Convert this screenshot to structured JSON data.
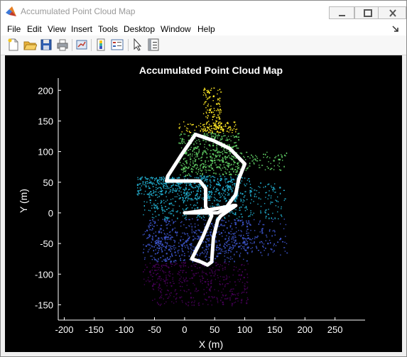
{
  "window": {
    "title": "Accumulated Point Cloud Map"
  },
  "menu": {
    "items": [
      "File",
      "Edit",
      "View",
      "Insert",
      "Tools",
      "Desktop",
      "Window",
      "Help"
    ]
  },
  "toolbar": {
    "buttons": [
      "new-figure",
      "open-file",
      "save",
      "print",
      "link-plot",
      "insert-colorbar",
      "insert-legend",
      "edit-plot",
      "property-inspector"
    ]
  },
  "colors": {
    "figure_background": "#000000",
    "axes_text": "#ffffff",
    "trajectory": "#ffffff",
    "colormap": [
      "#440154",
      "#3b52c4",
      "#21a9c9",
      "#5ec962",
      "#fde725"
    ]
  },
  "chart_data": {
    "type": "scatter",
    "title": "Accumulated Point Cloud Map",
    "xlabel": "X (m)",
    "ylabel": "Y (m)",
    "xlim": [
      -210,
      300
    ],
    "ylim": [
      -175,
      220
    ],
    "xticks": [
      -200,
      -150,
      -100,
      -50,
      0,
      50,
      100,
      150,
      200,
      250
    ],
    "yticks": [
      -150,
      -100,
      -50,
      0,
      50,
      100,
      150,
      200
    ],
    "grid": false,
    "legend": "none",
    "colormap": "parula",
    "series": [
      {
        "points": [
          [
            0,
            0
          ],
          [
            30,
            0
          ],
          [
            55,
            0
          ],
          [
            80,
            12
          ],
          [
            85,
            12
          ],
          [
            60,
            -5
          ],
          [
            55,
            -12
          ],
          [
            48,
            -40
          ],
          [
            45,
            -80
          ],
          [
            38,
            -85
          ],
          [
            27,
            -80
          ],
          [
            12,
            -75
          ],
          [
            30,
            -40
          ],
          [
            45,
            -5
          ],
          [
            35,
            10
          ],
          [
            35,
            40
          ],
          [
            25,
            52
          ],
          [
            -30,
            52
          ],
          [
            -28,
            60
          ],
          [
            -5,
            95
          ],
          [
            18,
            128
          ],
          [
            48,
            118
          ],
          [
            75,
            105
          ],
          [
            100,
            80
          ],
          [
            90,
            55
          ],
          [
            85,
            30
          ],
          [
            70,
            10
          ],
          [
            40,
            5
          ],
          [
            5,
            0
          ]
        ]
      }
    ]
  }
}
